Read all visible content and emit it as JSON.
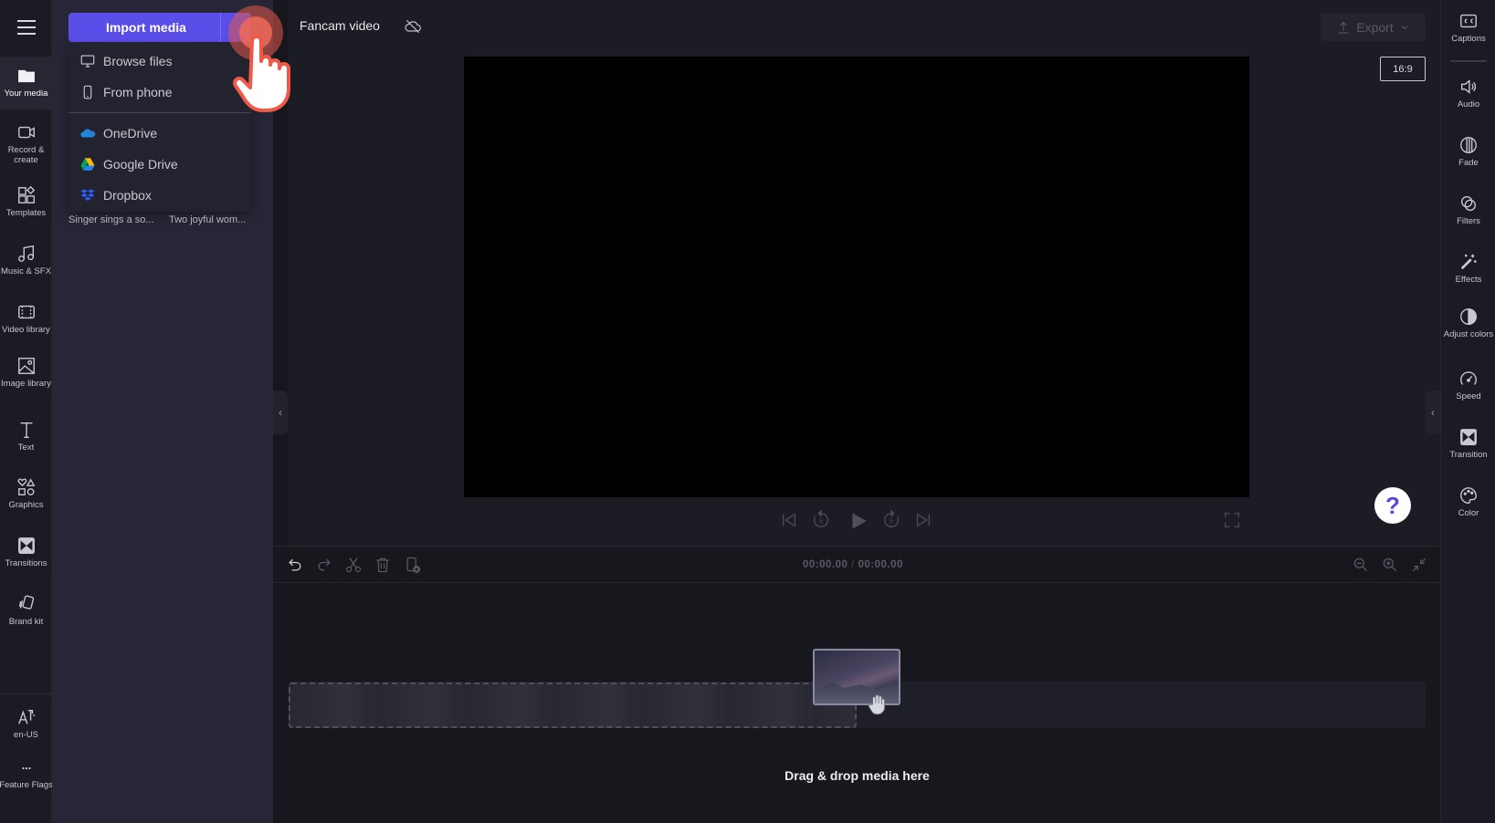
{
  "left_rail": {
    "menu_icon": "hamburger-icon",
    "items": [
      {
        "label": "Your media",
        "icon": "folder-icon",
        "active": true
      },
      {
        "label": "Record & create",
        "icon": "camera-icon"
      },
      {
        "label": "Templates",
        "icon": "templates-icon"
      },
      {
        "label": "Music & SFX",
        "icon": "music-note-icon"
      },
      {
        "label": "Video library",
        "icon": "film-icon"
      },
      {
        "label": "Image library",
        "icon": "image-icon"
      },
      {
        "label": "Text",
        "icon": "text-icon"
      },
      {
        "label": "Graphics",
        "icon": "shapes-icon"
      },
      {
        "label": "Transitions",
        "icon": "transition-icon"
      },
      {
        "label": "Brand kit",
        "icon": "brand-kit-icon"
      }
    ],
    "bottom_items": [
      {
        "label": "en-US",
        "icon": "language-icon"
      },
      {
        "label": "Feature Flags",
        "icon": "more-icon"
      }
    ]
  },
  "media_panel": {
    "import_button": "Import media",
    "dropdown": [
      {
        "label": "Browse files",
        "icon": "monitor-icon"
      },
      {
        "label": "From phone",
        "icon": "phone-icon"
      },
      {
        "label": "OneDrive",
        "icon": "onedrive-icon"
      },
      {
        "label": "Google Drive",
        "icon": "google-drive-icon"
      },
      {
        "label": "Dropbox",
        "icon": "dropbox-icon"
      }
    ],
    "media_captions": [
      "Singer sings a so...",
      "Two joyful wom..."
    ]
  },
  "topbar": {
    "project_name": "Fancam video",
    "cloud_status_icon": "cloud-off-icon",
    "export_label": "Export",
    "aspect_ratio": "16:9"
  },
  "playback": {
    "controls": [
      "skip-to-start",
      "rewind-5",
      "play",
      "forward-5",
      "skip-to-end"
    ],
    "rewind_seconds": "5",
    "forward_seconds": "5"
  },
  "timeline": {
    "current_time": "00:00.00",
    "separator": "/",
    "total_time": "00:00.00",
    "tools": [
      "undo",
      "redo",
      "split",
      "delete",
      "add-to-timeline"
    ],
    "zoom_tools": [
      "zoom-out",
      "zoom-in",
      "fit"
    ],
    "drop_hint": "Drag & drop media here"
  },
  "right_rail": {
    "items": [
      {
        "label": "Captions",
        "icon": "captions-icon"
      },
      {
        "label": "Audio",
        "icon": "speaker-icon"
      },
      {
        "label": "Fade",
        "icon": "fade-icon"
      },
      {
        "label": "Filters",
        "icon": "filters-icon"
      },
      {
        "label": "Effects",
        "icon": "magic-wand-icon"
      },
      {
        "label": "Adjust colors",
        "icon": "contrast-icon"
      },
      {
        "label": "Speed",
        "icon": "speedometer-icon"
      },
      {
        "label": "Transition",
        "icon": "transition-icon"
      },
      {
        "label": "Color",
        "icon": "palette-icon"
      }
    ]
  },
  "help": {
    "label": "?"
  },
  "colors": {
    "accent": "#5b4ee8",
    "pointer": "#ee5a48"
  }
}
